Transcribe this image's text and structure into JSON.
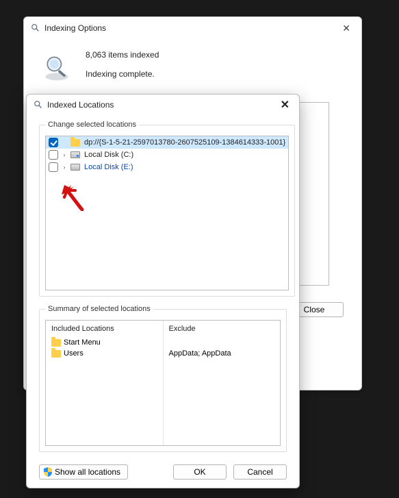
{
  "backWindow": {
    "title": "Indexing Options",
    "itemsIndexed": "8,063 items indexed",
    "statusLine": "Indexing complete.",
    "closeLabel": "Close"
  },
  "frontWindow": {
    "title": "Indexed Locations",
    "changeSection": "Change selected locations",
    "summarySection": "Summary of selected locations",
    "summary": {
      "includedHeader": "Included Locations",
      "excludeHeader": "Exclude",
      "rows": [
        {
          "name": "Start Menu",
          "exclude": ""
        },
        {
          "name": "Users",
          "exclude": "AppData; AppData"
        }
      ]
    },
    "buttons": {
      "showAll": "Show all locations",
      "ok": "OK",
      "cancel": "Cancel"
    },
    "tree": [
      {
        "checked": true,
        "expandable": false,
        "iconType": "folder",
        "label": "dp://{S-1-5-21-2597013780-2607525109-1384614333-1001}",
        "link": false,
        "selected": true
      },
      {
        "checked": false,
        "expandable": true,
        "iconType": "drive-c",
        "label": "Local Disk (C:)",
        "link": false,
        "selected": false
      },
      {
        "checked": false,
        "expandable": true,
        "iconType": "drive",
        "label": "Local Disk (E:)",
        "link": true,
        "selected": false
      }
    ]
  }
}
